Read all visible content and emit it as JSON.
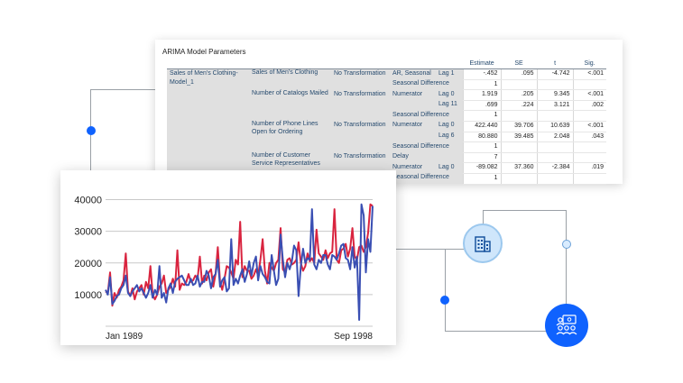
{
  "colors": {
    "accent": "#0f62fe",
    "series_red": "#d9243f",
    "series_blue": "#3a4fb3",
    "node_light": "#cfe6fb"
  },
  "table": {
    "title": "ARIMA Model Parameters",
    "headers": [
      "Estimate",
      "SE",
      "t",
      "Sig."
    ],
    "model_label": "Sales of Men's Clothing-Model_1",
    "rows": [
      {
        "variable": "Sales of Men's Clothing",
        "transform": "No Transformation",
        "param": "AR, Seasonal",
        "lag": "Lag 1",
        "estimate": "-.452",
        "se": ".095",
        "t": "-4.742",
        "sig": "<.001"
      },
      {
        "variable": "",
        "transform": "",
        "param": "Seasonal Difference",
        "lag": "",
        "estimate": "1",
        "se": "",
        "t": "",
        "sig": ""
      },
      {
        "variable": "Number of Catalogs Mailed",
        "transform": "No Transformation",
        "param": "Numerator",
        "lag": "Lag 0",
        "estimate": "1.919",
        "se": ".205",
        "t": "9.345",
        "sig": "<.001"
      },
      {
        "variable": "",
        "transform": "",
        "param": "",
        "lag": "Lag 11",
        "estimate": ".699",
        "se": ".224",
        "t": "3.121",
        "sig": ".002"
      },
      {
        "variable": "",
        "transform": "",
        "param": "Seasonal Difference",
        "lag": "",
        "estimate": "1",
        "se": "",
        "t": "",
        "sig": ""
      },
      {
        "variable": "Number of Phone Lines Open for Ordering",
        "transform": "No Transformation",
        "param": "Numerator",
        "lag": "Lag 0",
        "estimate": "422.440",
        "se": "39.706",
        "t": "10.639",
        "sig": "<.001"
      },
      {
        "variable": "",
        "transform": "",
        "param": "",
        "lag": "Lag 6",
        "estimate": "80.880",
        "se": "39.485",
        "t": "2.048",
        "sig": ".043"
      },
      {
        "variable": "",
        "transform": "",
        "param": "Seasonal Difference",
        "lag": "",
        "estimate": "1",
        "se": "",
        "t": "",
        "sig": ""
      },
      {
        "variable": "Number of Customer Service Representatives",
        "transform": "No Transformation",
        "param": "Delay",
        "lag": "",
        "estimate": "7",
        "se": "",
        "t": "",
        "sig": ""
      },
      {
        "variable": "",
        "transform": "",
        "param": "Numerator",
        "lag": "Lag 0",
        "estimate": "-89.082",
        "se": "37.360",
        "t": "-2.384",
        "sig": ".019"
      },
      {
        "variable": "",
        "transform": "",
        "param": "Seasonal Difference",
        "lag": "",
        "estimate": "1",
        "se": "",
        "t": "",
        "sig": ""
      }
    ]
  },
  "chart_data": {
    "type": "line",
    "ylim": [
      0,
      43000
    ],
    "yticks": [
      10000,
      20000,
      30000,
      40000
    ],
    "ytick_labels": [
      "10000",
      "20000",
      "30000",
      "40000"
    ],
    "xtick_labels": [
      "Jan 1989",
      "Sep 1998"
    ],
    "grid": true,
    "x": [
      1,
      2,
      3,
      4,
      5,
      6,
      7,
      8,
      9,
      10,
      11,
      12,
      13,
      14,
      15,
      16,
      17,
      18,
      19,
      20,
      21,
      22,
      23,
      24,
      25,
      26,
      27,
      28,
      29,
      30,
      31,
      32,
      33,
      34,
      35,
      36,
      37,
      38,
      39,
      40,
      41,
      42,
      43,
      44,
      45,
      46,
      47,
      48,
      49,
      50,
      51,
      52,
      53,
      54,
      55,
      56,
      57,
      58,
      59,
      60,
      61,
      62,
      63,
      64,
      65,
      66,
      67,
      68,
      69,
      70,
      71,
      72,
      73,
      74,
      75,
      76,
      77,
      78,
      79,
      80,
      81,
      82,
      83,
      84,
      85,
      86,
      87,
      88,
      89,
      90,
      91,
      92,
      93,
      94,
      95,
      96,
      97,
      98,
      99,
      100,
      101,
      102,
      103,
      104,
      105,
      106,
      107,
      108,
      109,
      110,
      111,
      112,
      113,
      114,
      115,
      116,
      117,
      118,
      119,
      120
    ],
    "series": [
      {
        "values": [
          11000,
          10500,
          17000,
          6500,
          10500,
          9000,
          11500,
          12500,
          14500,
          23000,
          11000,
          9500,
          12000,
          8500,
          11000,
          12000,
          13000,
          10000,
          14000,
          12000,
          19000,
          10000,
          8500,
          10000,
          12500,
          13500,
          16000,
          10500,
          11500,
          12500,
          15000,
          12500,
          24000,
          11500,
          13500,
          13000,
          14000,
          16500,
          14000,
          14500,
          16000,
          15000,
          22000,
          13500,
          16000,
          14500,
          17000,
          18000,
          12500,
          16500,
          25000,
          14000,
          11500,
          15000,
          19000,
          18500,
          17000,
          15000,
          21000,
          19500,
          33000,
          15500,
          19000,
          17500,
          17500,
          15000,
          16000,
          18000,
          16000,
          21000,
          27500,
          17500,
          13500,
          20000,
          18500,
          17500,
          20000,
          21000,
          31000,
          18000,
          17000,
          21000,
          21500,
          19500,
          20000,
          21000,
          26500,
          20000,
          17500,
          19000,
          23000,
          20500,
          21500,
          20000,
          30500,
          23000,
          22000,
          21000,
          24000,
          21500,
          23000,
          23500,
          37000,
          21000,
          20000,
          24000,
          24500,
          26000,
          22000,
          24500,
          31000,
          22000,
          21000,
          25000,
          25500,
          23500,
          25000,
          29500,
          38500,
          38000
        ]
      },
      {
        "values": [
          11500,
          10000,
          15500,
          7000,
          8000,
          9500,
          10000,
          12000,
          13000,
          16000,
          10500,
          9500,
          11000,
          12000,
          13000,
          11000,
          12000,
          10500,
          9000,
          10500,
          13000,
          9000,
          11500,
          10000,
          19000,
          9000,
          10500,
          7500,
          12000,
          13500,
          10500,
          14000,
          15000,
          15500,
          16000,
          14500,
          13000,
          13000,
          15000,
          13000,
          13500,
          16000,
          12500,
          14000,
          14000,
          17500,
          16000,
          12000,
          15500,
          16500,
          21000,
          12500,
          14500,
          15500,
          11000,
          12000,
          27500,
          13000,
          15000,
          13500,
          16000,
          18000,
          14000,
          16500,
          20500,
          16000,
          20000,
          22000,
          14500,
          19000,
          16500,
          15500,
          14000,
          13500,
          22500,
          17500,
          13000,
          15000,
          29000,
          21000,
          15500,
          20000,
          18000,
          20500,
          25500,
          24000,
          9500,
          19000,
          24500,
          20000,
          21500,
          21000,
          37000,
          19500,
          18000,
          21000,
          20000,
          22500,
          22500,
          19500,
          18000,
          22500,
          22000,
          21000,
          23000,
          25500,
          26000,
          21500,
          21000,
          18000,
          25000,
          18500,
          22000,
          2000,
          38500,
          35000,
          17000,
          27500,
          23500,
          38000
        ]
      }
    ]
  }
}
